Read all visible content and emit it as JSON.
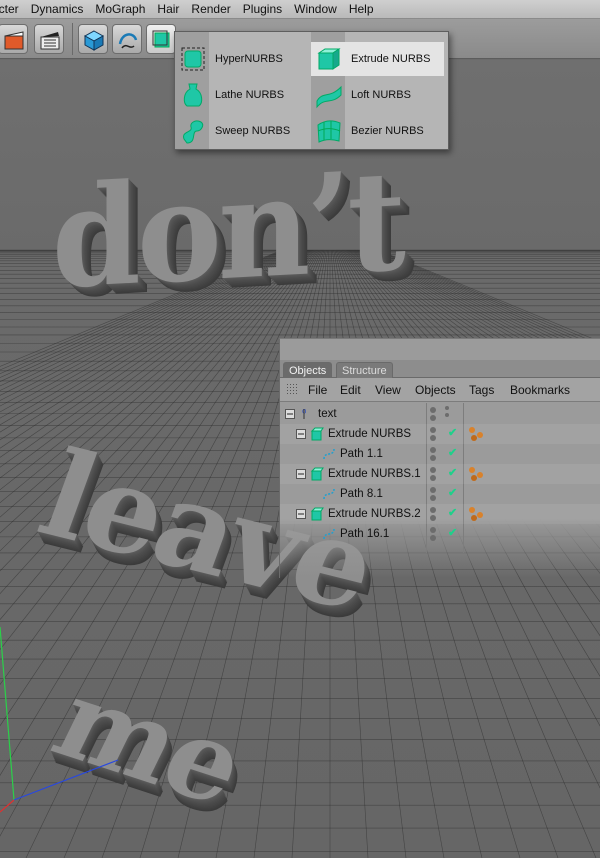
{
  "menubar": {
    "items": [
      "acter",
      "Dynamics",
      "MoGraph",
      "Hair",
      "Render",
      "Plugins",
      "Window",
      "Help"
    ]
  },
  "toolbar": {
    "buttons": [
      "clapper-red-icon",
      "clapper-film-icon",
      "cube-icon",
      "spline-pen-icon",
      "nurbs-icon",
      "sphere-icon",
      "star-icon",
      "light-icon",
      "camera-icon"
    ],
    "accent": "#1fc7a6"
  },
  "nurbs_menu": {
    "items": [
      {
        "label": "HyperNURBS",
        "icon": "hypernurbs-icon"
      },
      {
        "label": "Extrude NURBS",
        "icon": "extrude-nurbs-icon",
        "highlighted": true
      },
      {
        "label": "Lathe NURBS",
        "icon": "lathe-nurbs-icon"
      },
      {
        "label": "Loft NURBS",
        "icon": "loft-nurbs-icon"
      },
      {
        "label": "Sweep NURBS",
        "icon": "sweep-nurbs-icon"
      },
      {
        "label": "Bezier NURBS",
        "icon": "bezier-nurbs-icon"
      }
    ]
  },
  "scene": {
    "words": [
      "don’t",
      "leave",
      "me"
    ]
  },
  "object_manager": {
    "tabs": [
      "Objects",
      "Structure"
    ],
    "menu": [
      "File",
      "Edit",
      "View",
      "Objects",
      "Tags",
      "Bookmarks"
    ],
    "objects": [
      {
        "name": "text",
        "level": 0,
        "icon": "null-icon",
        "tag": false,
        "check": false
      },
      {
        "name": "Extrude NURBS",
        "level": 1,
        "icon": "extrude-nurbs-icon",
        "tag": true,
        "check": true
      },
      {
        "name": "Path 1.1",
        "level": 2,
        "icon": "path-spline-icon",
        "tag": false,
        "check": true
      },
      {
        "name": "Extrude NURBS.1",
        "level": 1,
        "icon": "extrude-nurbs-icon",
        "tag": true,
        "check": true
      },
      {
        "name": "Path 8.1",
        "level": 2,
        "icon": "path-spline-icon",
        "tag": false,
        "check": true
      },
      {
        "name": "Extrude NURBS.2",
        "level": 1,
        "icon": "extrude-nurbs-icon",
        "tag": true,
        "check": true
      },
      {
        "name": "Path 16.1",
        "level": 2,
        "icon": "path-spline-icon",
        "tag": false,
        "check": true
      }
    ],
    "check_color": "#1fd08a",
    "tag_color": "#d9822b"
  }
}
